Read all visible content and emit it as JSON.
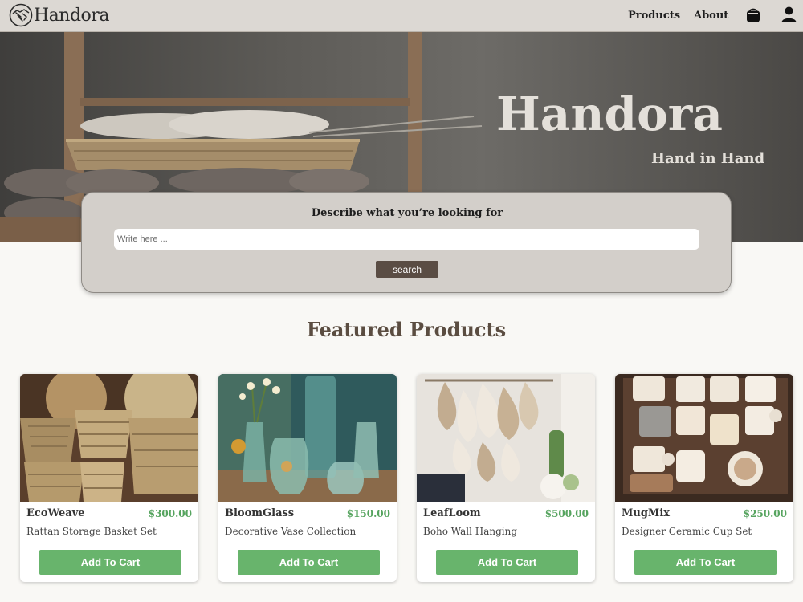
{
  "header": {
    "brand": "Handora",
    "nav": {
      "products": "Products",
      "about": "About"
    }
  },
  "hero": {
    "title": "Handora",
    "tagline": "Hand in Hand"
  },
  "search": {
    "label": "Describe what you’re looking for",
    "placeholder": "Write here ...",
    "value": "",
    "button_label": "search"
  },
  "featured": {
    "title": "Featured Products",
    "products": [
      {
        "brand": "EcoWeave",
        "price": "$300.00",
        "name": "Rattan Storage Basket Set",
        "button_label": "Add To Cart"
      },
      {
        "brand": "BloomGlass",
        "price": "$150.00",
        "name": "Decorative Vase Collection",
        "button_label": "Add To Cart"
      },
      {
        "brand": "LeafLoom",
        "price": "$500.00",
        "name": "Boho Wall Hanging",
        "button_label": "Add To Cart"
      },
      {
        "brand": "MugMix",
        "price": "$250.00",
        "name": "Designer Ceramic Cup Set",
        "button_label": "Add To Cart"
      }
    ]
  },
  "icons": {
    "logo": "handshake-icon",
    "cart": "shopping-bag-icon",
    "account": "user-icon"
  },
  "colors": {
    "navbar": "#dcd8d3",
    "search_button": "#5a4d44",
    "price": "#56a45f",
    "add_to_cart": "#68b46c",
    "section_title": "#5b4d41"
  }
}
